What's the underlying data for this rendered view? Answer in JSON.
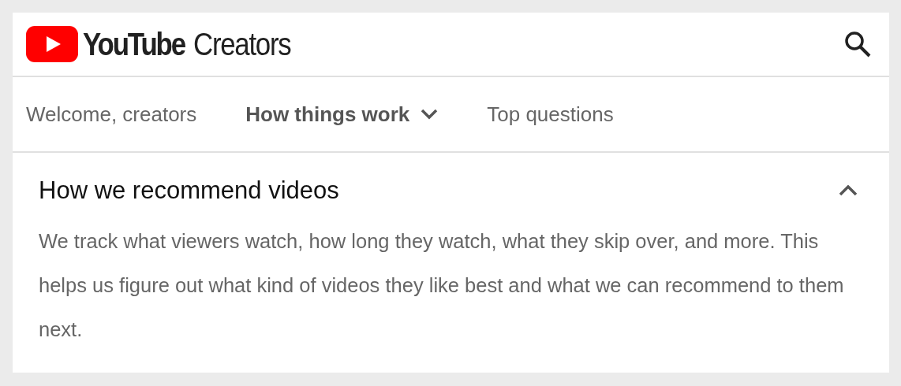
{
  "header": {
    "logo_word": "YouTube",
    "logo_suffix": "Creators"
  },
  "nav": [
    {
      "label": "Welcome, creators",
      "selected": false,
      "has_menu": false
    },
    {
      "label": "How things work",
      "selected": true,
      "has_menu": true
    },
    {
      "label": "Top questions",
      "selected": false,
      "has_menu": false
    }
  ],
  "section": {
    "title": "How we recommend videos",
    "expanded": true,
    "body": "We track what viewers watch, how long they watch, what they skip over, and more. This helps us figure out what kind of videos they like best and what we can recommend to them next."
  }
}
